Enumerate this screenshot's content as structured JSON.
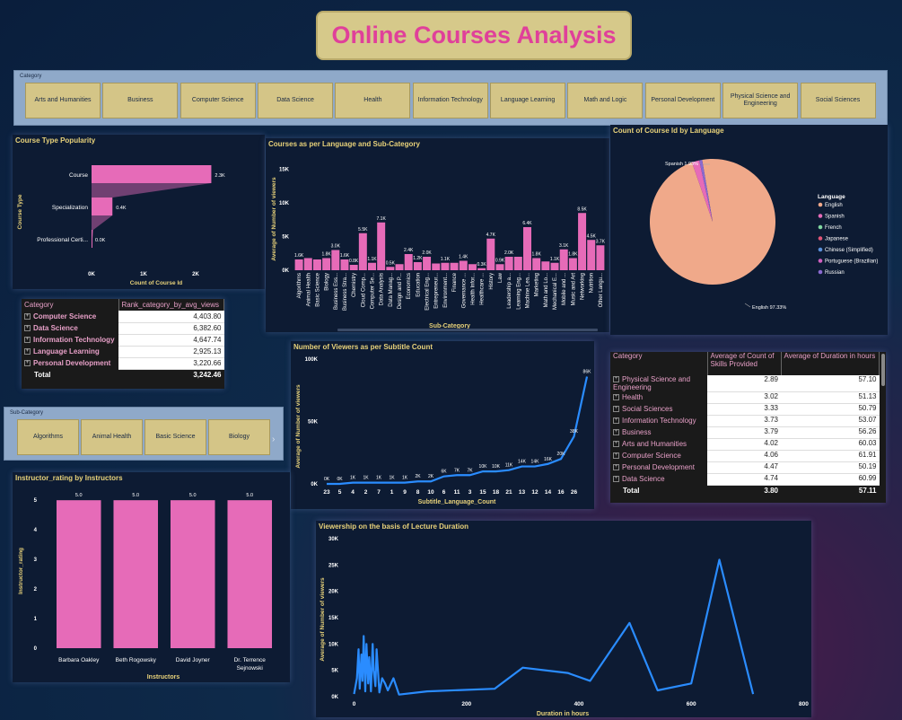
{
  "title": "Online Courses Analysis",
  "category_slicer": {
    "label": "Category",
    "items": [
      "Arts and Humanities",
      "Business",
      "Computer Science",
      "Data Science",
      "Health",
      "Information Technology",
      "Language Learning",
      "Math and Logic",
      "Personal Development",
      "Physical Science and Engineering",
      "Social Sciences"
    ]
  },
  "subcategory_slicer": {
    "label": "Sub-Category",
    "items": [
      "Algorithms",
      "Animal Health",
      "Basic Science",
      "Biology"
    ],
    "next_icon": "chevron-right-icon"
  },
  "rank_table": {
    "headers": [
      "Category",
      "Rank_category_by_avg_views"
    ],
    "rows": [
      {
        "category": "Computer Science",
        "value": "4,403.80"
      },
      {
        "category": "Data Science",
        "value": "6,382.60"
      },
      {
        "category": "Information Technology",
        "value": "4,647.74"
      },
      {
        "category": "Language Learning",
        "value": "2,925.13"
      },
      {
        "category": "Personal Development",
        "value": "3,220.66"
      }
    ],
    "total_label": "Total",
    "total_value": "3,242.46"
  },
  "skills_table": {
    "headers": [
      "Category",
      "Average of Count of Skills Provided",
      "Average of Duration in hours"
    ],
    "rows": [
      {
        "category": "Physical Science and Engineering",
        "skills": "2.89",
        "duration": "57.10"
      },
      {
        "category": "Health",
        "skills": "3.02",
        "duration": "51.13"
      },
      {
        "category": "Social Sciences",
        "skills": "3.33",
        "duration": "50.79"
      },
      {
        "category": "Information Technology",
        "skills": "3.73",
        "duration": "53.07"
      },
      {
        "category": "Business",
        "skills": "3.79",
        "duration": "56.26"
      },
      {
        "category": "Arts and Humanities",
        "skills": "4.02",
        "duration": "60.03"
      },
      {
        "category": "Computer Science",
        "skills": "4.06",
        "duration": "61.91"
      },
      {
        "category": "Personal Development",
        "skills": "4.47",
        "duration": "50.19"
      },
      {
        "category": "Data Science",
        "skills": "4.74",
        "duration": "60.99"
      }
    ],
    "total_label": "Total",
    "total_skills": "3.80",
    "total_duration": "57.11"
  },
  "chart_data": [
    {
      "id": "course_type",
      "type": "bar",
      "orientation": "horizontal",
      "title": "Course Type Popularity",
      "xlabel": "Count of Course Id",
      "ylabel": "Course Type",
      "categories": [
        "Course",
        "Specialization",
        "Professional Certi..."
      ],
      "values": [
        2300,
        400,
        0
      ],
      "data_labels": [
        "2.3K",
        "0.4K",
        "0.0K"
      ],
      "xticks": [
        "0K",
        "1K",
        "2K"
      ],
      "xlim": [
        0,
        2500
      ],
      "color": "#e66bb8"
    },
    {
      "id": "lang_subcat",
      "type": "bar",
      "title": "Courses as per Language and Sub-Category",
      "xlabel": "Sub-Category",
      "ylabel": "Average of Number of viewers",
      "categories": [
        "Algorithms",
        "Animal Health",
        "Basic Science",
        "Biology",
        "Business Ess...",
        "Business Stra...",
        "Chemistry",
        "Cloud Comp...",
        "Computer Se...",
        "Data Analysis",
        "Data Manag...",
        "Design and P...",
        "Economics",
        "Education",
        "Electrical Eng...",
        "Entrepreneur...",
        "Environment...",
        "Finance",
        "Governance ...",
        "Health Infor...",
        "Healthcare ...",
        "History",
        "Law",
        "Leadership a...",
        "Learning Eng...",
        "Machine Lea...",
        "Marketing",
        "Math and Lo...",
        "Mechanical E...",
        "Mobile and ...",
        "Music and Art",
        "Networking",
        "Nutrition",
        "Other Langu..."
      ],
      "values": [
        1600,
        1800,
        1600,
        1800,
        3000,
        1600,
        800,
        5500,
        1100,
        7100,
        500,
        900,
        2400,
        1200,
        2000,
        1000,
        1100,
        1100,
        1400,
        900,
        300,
        4700,
        900,
        2000,
        2000,
        6400,
        1800,
        1300,
        1100,
        3100,
        1800,
        8500,
        4500,
        3700
      ],
      "data_labels": [
        "1.6K",
        "",
        "",
        "1.8K",
        "3.0K",
        "1.6K",
        "0.8K",
        "5.5K",
        "1.1K",
        "7.1K",
        "0.5K",
        "",
        "2.4K",
        "1.2K",
        "2.0K",
        "",
        "1.1K",
        "",
        "1.4K",
        "",
        "0.3K",
        "4.7K",
        "0.9K",
        "2.0K",
        "",
        "6.4K",
        "1.8K",
        "",
        "1.1K",
        "3.1K",
        "1.8K",
        "8.5K",
        "4.5K",
        "3.7K"
      ],
      "yticks": [
        "0K",
        "5K",
        "10K",
        "15K"
      ],
      "ylim": [
        0,
        16000
      ],
      "color": "#e66bb8"
    },
    {
      "id": "language_pie",
      "type": "pie",
      "title": "Count of Course Id by Language",
      "legend_title": "Language",
      "legend": [
        {
          "name": "English",
          "color": "#f0a98a"
        },
        {
          "name": "Spanish",
          "color": "#e66bb8"
        },
        {
          "name": "French",
          "color": "#7fd6a0"
        },
        {
          "name": "Japanese",
          "color": "#e05577"
        },
        {
          "name": "Chinese (Simplified)",
          "color": "#5a8fd8"
        },
        {
          "name": "Portuguese (Brazilian)",
          "color": "#d060c0"
        },
        {
          "name": "Russian",
          "color": "#8a6ad0"
        }
      ],
      "slices": [
        {
          "name": "English",
          "value": 97.33,
          "label": "English 97.33%"
        },
        {
          "name": "Spanish",
          "value": 1.93,
          "label": "Spanish 1.93%"
        },
        {
          "name": "Other",
          "value": 0.74,
          "label": ""
        }
      ]
    },
    {
      "id": "subtitle_views",
      "type": "line",
      "title": "Number of Viewers as per Subtitle Count",
      "xlabel": "Subtitle_Language_Count",
      "ylabel": "Average of Number of viewers",
      "categories": [
        "23",
        "5",
        "4",
        "2",
        "7",
        "1",
        "9",
        "8",
        "10",
        "6",
        "11",
        "3",
        "15",
        "18",
        "21",
        "13",
        "12",
        "14",
        "16",
        "26"
      ],
      "values": [
        0,
        0,
        1000,
        1000,
        1000,
        1000,
        1000,
        2000,
        2000,
        6000,
        7000,
        7000,
        10000,
        10000,
        11000,
        14000,
        14000,
        16000,
        20000,
        38000,
        86000
      ],
      "data_labels": [
        "0K",
        "0K",
        "1K",
        "1K",
        "1K",
        "1K",
        "1K",
        "2K",
        "2K",
        "6K",
        "7K",
        "7K",
        "10K",
        "10K",
        "11K",
        "14K",
        "14K",
        "16K",
        "20K",
        "38K",
        "86K"
      ],
      "yticks": [
        "0K",
        "50K",
        "100K"
      ],
      "ylim": [
        0,
        100000
      ],
      "color": "#2a8cff"
    },
    {
      "id": "instructor_rating",
      "type": "bar",
      "title": "Instructor_rating by Instructors",
      "xlabel": "Instructors",
      "ylabel": "Instructor_rating",
      "categories": [
        "Barbara Oakley",
        "Beth Rogowsky",
        "David Joyner",
        "Dr. Terrence Sejnowski"
      ],
      "values": [
        5.0,
        5.0,
        5.0,
        5.0
      ],
      "data_labels": [
        "5.0",
        "5.0",
        "5.0",
        "5.0"
      ],
      "yticks": [
        "0",
        "1",
        "2",
        "3",
        "4",
        "5"
      ],
      "ylim": [
        0,
        5.4
      ],
      "color": "#e66bb8"
    },
    {
      "id": "duration_views",
      "type": "line",
      "title": "Viewership on the basis of Lecture Duration",
      "xlabel": "Duration in hours",
      "ylabel": "Average of Number of viewers",
      "x": [
        0,
        5,
        8,
        10,
        13,
        15,
        17,
        20,
        22,
        25,
        27,
        30,
        33,
        35,
        38,
        40,
        45,
        50,
        55,
        60,
        70,
        80,
        130,
        250,
        300,
        380,
        420,
        490,
        540,
        600,
        650,
        710
      ],
      "y": [
        500,
        3500,
        9000,
        1500,
        8000,
        3000,
        11500,
        1000,
        10000,
        2500,
        7500,
        1000,
        10000,
        5000,
        2000,
        9000,
        800,
        3500,
        2500,
        1200,
        3500,
        400,
        1000,
        1500,
        5500,
        4500,
        3000,
        14000,
        1200,
        2500,
        26000,
        500
      ],
      "xticks": [
        "0",
        "200",
        "400",
        "600",
        "800"
      ],
      "yticks": [
        "0K",
        "5K",
        "10K",
        "15K",
        "20K",
        "25K",
        "30K"
      ],
      "xlim": [
        -20,
        820
      ],
      "ylim": [
        0,
        30000
      ],
      "color": "#2a8cff"
    }
  ]
}
